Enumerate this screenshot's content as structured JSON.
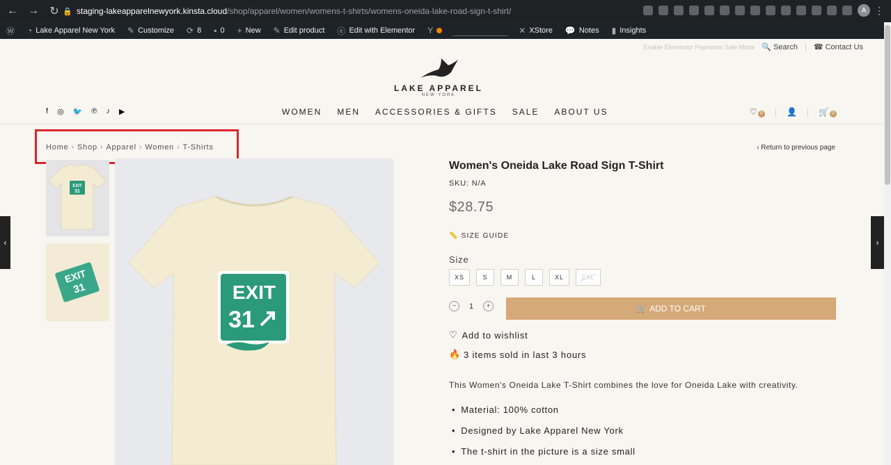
{
  "browser": {
    "url_host": "staging-lakeapparelnewyork.kinsta.cloud",
    "url_path": "/shop/apparel/women/womens-t-shirts/womens-oneida-lake-road-sign-t-shirt/",
    "profile_initial": "A"
  },
  "admin_bar": {
    "site_name": "Lake Apparel New York",
    "customize": "Customize",
    "updates": "8",
    "comments": "0",
    "new": "New",
    "edit_product": "Edit product",
    "elementor": "Edit with Elementor",
    "xstore": "XStore",
    "notes": "Notes",
    "insights": "Insights"
  },
  "top_links": {
    "faded": "Enable Elementor Payments Safe Mode",
    "search": "Search",
    "contact": "Contact Us"
  },
  "logo": {
    "name": "LAKE APPAREL",
    "sub": "NEW YORK"
  },
  "nav": [
    "WOMEN",
    "MEN",
    "ACCESSORIES & GIFTS",
    "SALE",
    "ABOUT US"
  ],
  "header": {
    "wishlist_count": "0",
    "cart_count": "0"
  },
  "breadcrumb": [
    "Home",
    "Shop",
    "Apparel",
    "Women",
    "T-Shirts"
  ],
  "return_link": "Return to previous page",
  "product": {
    "title": "Women's Oneida Lake Road Sign T-Shirt",
    "sku": "SKU: N/A",
    "price": "$28.75",
    "size_guide": "SIZE GUIDE",
    "size_label": "Size",
    "sizes": [
      "XS",
      "S",
      "M",
      "L",
      "XL",
      "2XL"
    ],
    "quantity": "1",
    "add_to_cart": "ADD TO CART",
    "wishlist": "Add to wishlist",
    "sold": "3 items sold in last 3 hours",
    "description": "This Women's Oneida Lake T-Shirt combines the love for Oneida Lake with creativity.",
    "features": [
      "Material: 100% cotton",
      "Designed by Lake Apparel New York",
      "The t-shirt in the picture is a size small"
    ],
    "sign_text_1": "EXIT",
    "sign_text_2": "31"
  },
  "colors": {
    "accent": "#d6a979",
    "sign_green": "#2a9a7a",
    "shirt": "#f4ecd2",
    "highlight": "#d9262b"
  }
}
